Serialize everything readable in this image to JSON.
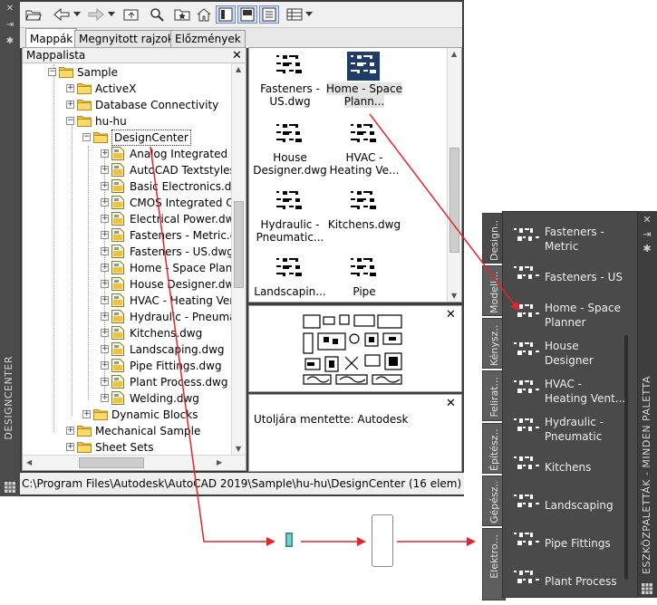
{
  "design_center": {
    "side_title": "DESIGNCENTER",
    "tabs": [
      {
        "label": "Mappák",
        "active": true
      },
      {
        "label": "Megnyitott rajzok",
        "active": false
      },
      {
        "label": "Előzmények",
        "active": false
      }
    ],
    "tree_header": "Mappalista",
    "tree": [
      {
        "label": "Sample",
        "kind": "folder",
        "expander": "-"
      },
      {
        "label": "ActiveX",
        "kind": "folder",
        "expander": "+"
      },
      {
        "label": "Database Connectivity",
        "kind": "folder",
        "expander": "+"
      },
      {
        "label": "hu-hu",
        "kind": "folder",
        "expander": "-"
      },
      {
        "label": "DesignCenter",
        "kind": "folder",
        "expander": "-",
        "selected": true
      },
      {
        "label": "Analog Integrated Ci",
        "kind": "dwg",
        "expander": "+"
      },
      {
        "label": "AutoCAD Textstyles a",
        "kind": "dwg",
        "expander": "+"
      },
      {
        "label": "Basic Electronics.dwg",
        "kind": "dwg",
        "expander": "+"
      },
      {
        "label": "CMOS Integrated Cir",
        "kind": "dwg",
        "expander": "+"
      },
      {
        "label": "Electrical Power.dwg",
        "kind": "dwg",
        "expander": "+"
      },
      {
        "label": "Fasteners - Metric.dv",
        "kind": "dwg",
        "expander": "+"
      },
      {
        "label": "Fasteners - US.dwg",
        "kind": "dwg",
        "expander": "+"
      },
      {
        "label": "Home - Space Plann",
        "kind": "dwg",
        "expander": "+"
      },
      {
        "label": "House Designer.dwg",
        "kind": "dwg",
        "expander": "+"
      },
      {
        "label": "HVAC - Heating Vent",
        "kind": "dwg",
        "expander": "+"
      },
      {
        "label": "Hydraulic - Pneumat",
        "kind": "dwg",
        "expander": "+"
      },
      {
        "label": "Kitchens.dwg",
        "kind": "dwg",
        "expander": "+"
      },
      {
        "label": "Landscaping.dwg",
        "kind": "dwg",
        "expander": "+"
      },
      {
        "label": "Pipe Fittings.dwg",
        "kind": "dwg",
        "expander": "+"
      },
      {
        "label": "Plant Process.dwg",
        "kind": "dwg",
        "expander": "+"
      },
      {
        "label": "Welding.dwg",
        "kind": "dwg",
        "expander": "+"
      },
      {
        "label": "Dynamic Blocks",
        "kind": "folder",
        "expander": "+"
      },
      {
        "label": "Mechanical Sample",
        "kind": "folder",
        "expander": "+"
      },
      {
        "label": "Sheet Sets",
        "kind": "folder",
        "expander": "+"
      }
    ],
    "content_items": [
      {
        "label": "Fasteners - US.dwg"
      },
      {
        "label": "Home - Space Plann...",
        "selected": true
      },
      {
        "label": "House Designer.dwg"
      },
      {
        "label": "HVAC - Heating Ve..."
      },
      {
        "label": "Hydraulic - Pneumatic..."
      },
      {
        "label": "Kitchens.dwg"
      },
      {
        "label": "Landscapin..."
      },
      {
        "label": "Pipe"
      }
    ],
    "description": "Utoljára mentette: Autodesk",
    "status_path": "C:\\Program Files\\Autodesk\\AutoCAD 2019\\Sample\\hu-hu\\DesignCenter (16 elem)"
  },
  "tool_palette": {
    "side_title": "ESZKÖZPALETTÁK - MINDEN PALETTA",
    "tabs": [
      "Design...",
      "Modell...",
      "Kénysz...",
      "Felirat...",
      "Építész...",
      "Gépész...",
      "Elektro..."
    ],
    "items": [
      {
        "label": "Fasteners -\nMetric"
      },
      {
        "label": "Fasteners - US"
      },
      {
        "label": "Home - Space\nPlanner"
      },
      {
        "label": "House\nDesigner"
      },
      {
        "label": "HVAC -\nHeating Vent..."
      },
      {
        "label": "Hydraulic -\nPneumatic"
      },
      {
        "label": "Kitchens"
      },
      {
        "label": "Landscaping"
      },
      {
        "label": "Pipe Fittings"
      },
      {
        "label": "Plant Process"
      }
    ]
  },
  "colors": {
    "arrow": "#e3242b",
    "palette_bg": "#4a4a4a",
    "window_bg": "#3c3c3c"
  }
}
